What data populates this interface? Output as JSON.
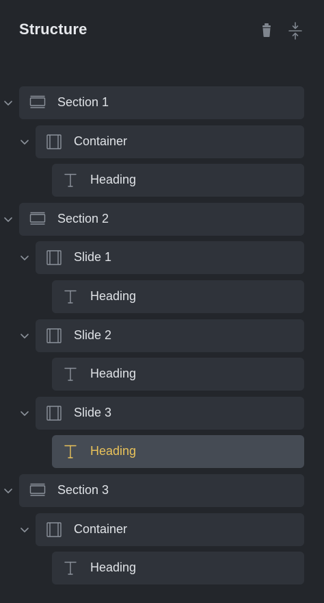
{
  "panel": {
    "title": "Structure",
    "actions": [
      {
        "icon": "trash-icon",
        "label": "Delete"
      },
      {
        "icon": "collapse-all-icon",
        "label": "Collapse all"
      }
    ]
  },
  "tree": [
    {
      "label": "Section 1",
      "type": "section",
      "depth": 0,
      "expanded": true,
      "active": false
    },
    {
      "label": "Container",
      "type": "container",
      "depth": 1,
      "expanded": true,
      "active": false
    },
    {
      "label": "Heading",
      "type": "heading",
      "depth": 2,
      "expanded": null,
      "active": false
    },
    {
      "label": "Section 2",
      "type": "section",
      "depth": 0,
      "expanded": true,
      "active": false
    },
    {
      "label": "Slide 1",
      "type": "container",
      "depth": 1,
      "expanded": true,
      "active": false
    },
    {
      "label": "Heading",
      "type": "heading",
      "depth": 2,
      "expanded": null,
      "active": false
    },
    {
      "label": "Slide 2",
      "type": "container",
      "depth": 1,
      "expanded": true,
      "active": false
    },
    {
      "label": "Heading",
      "type": "heading",
      "depth": 2,
      "expanded": null,
      "active": false
    },
    {
      "label": "Slide 3",
      "type": "container",
      "depth": 1,
      "expanded": true,
      "active": false
    },
    {
      "label": "Heading",
      "type": "heading",
      "depth": 2,
      "expanded": null,
      "active": true
    },
    {
      "label": "Section 3",
      "type": "section",
      "depth": 0,
      "expanded": true,
      "active": false
    },
    {
      "label": "Container",
      "type": "container",
      "depth": 1,
      "expanded": true,
      "active": false
    },
    {
      "label": "Heading",
      "type": "heading",
      "depth": 2,
      "expanded": null,
      "active": false
    }
  ],
  "colors": {
    "background": "#23262b",
    "row": "#2f333a",
    "row_active": "#454b54",
    "text": "#dfe2e6",
    "active_text": "#e9c25a",
    "icon": "#8c929b"
  }
}
